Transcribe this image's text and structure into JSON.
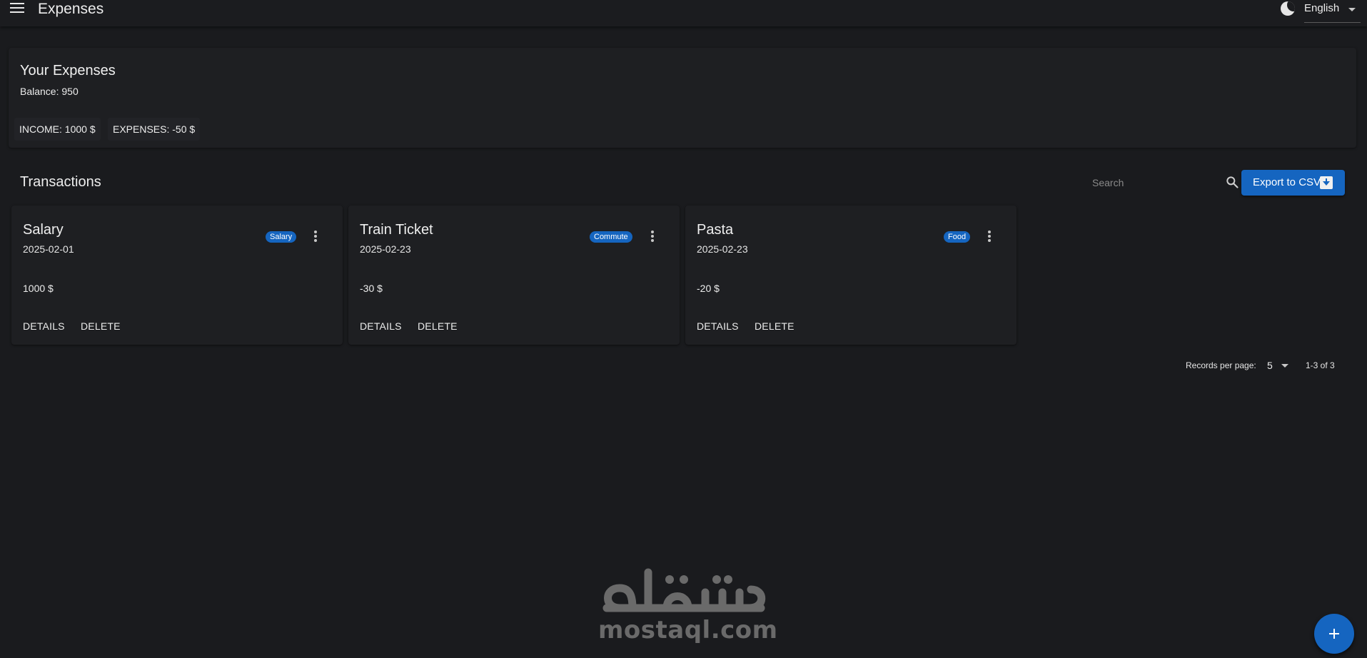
{
  "header": {
    "menu_icon": "hamburger-menu-icon",
    "title": "Expenses",
    "theme_icon": "dark-mode-moon-icon",
    "language": "English"
  },
  "summary": {
    "title": "Your Expenses",
    "balance": "Balance: 950",
    "income_chip": "INCOME: 1000 $",
    "expenses_chip": "EXPENSES: -50 $"
  },
  "transactions": {
    "title": "Transactions",
    "search_placeholder": "Search",
    "search_icon": "search-icon",
    "export_label": "Export to CSV",
    "export_icon": "download-icon",
    "items": [
      {
        "name": "Salary",
        "date": "2025-02-01",
        "category": "Salary",
        "amount": "1000 $",
        "details_label": "DETAILS",
        "delete_label": "DELETE"
      },
      {
        "name": "Train Ticket",
        "date": "2025-02-23",
        "category": "Commute",
        "amount": "-30 $",
        "details_label": "DETAILS",
        "delete_label": "DELETE"
      },
      {
        "name": "Pasta",
        "date": "2025-02-23",
        "category": "Food",
        "amount": "-20 $",
        "details_label": "DETAILS",
        "delete_label": "DELETE"
      }
    ]
  },
  "pagination": {
    "records_per_page_label": "Records per page:",
    "records_per_page": "5",
    "range": "1-3 of 3"
  },
  "watermark": {
    "arabic": "مستقل",
    "latin": "mostaql.com"
  },
  "fab_icon": "add-icon",
  "colors": {
    "background": "#1a1b1e",
    "surface": "#1e1f22",
    "accent": "#1565c0",
    "text": "#ececec"
  }
}
